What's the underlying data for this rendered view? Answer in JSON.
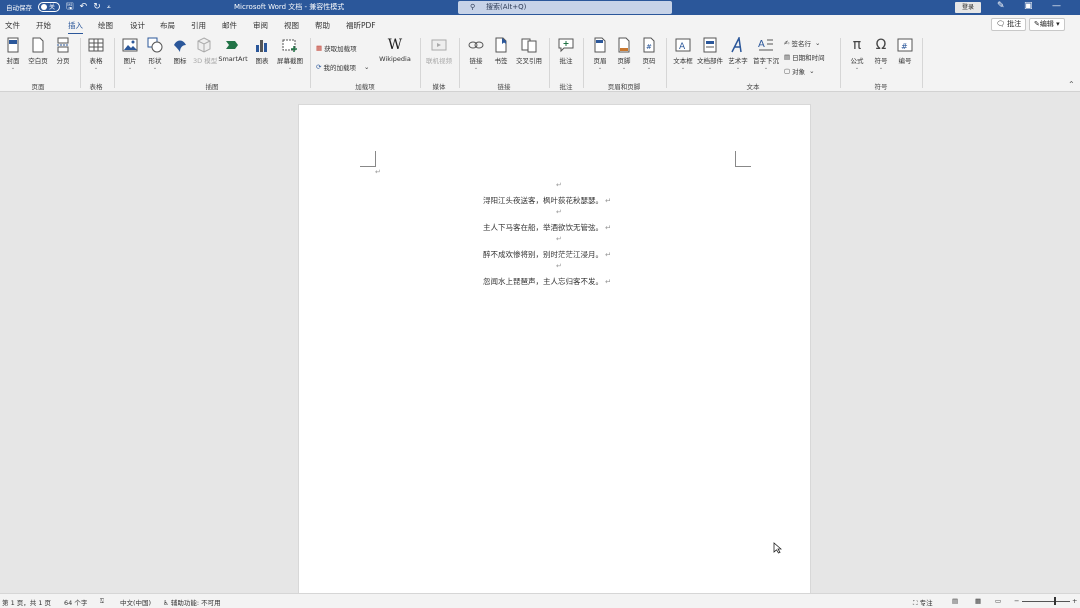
{
  "titlebar": {
    "autosave_label": "自动保存",
    "autosave_state": "关",
    "document_title": "Microsoft Word 文档  -  兼容性模式",
    "search_placeholder": "搜索(Alt+Q)",
    "login_label": "登录"
  },
  "menu": {
    "tabs": [
      "文件",
      "开始",
      "插入",
      "绘图",
      "设计",
      "布局",
      "引用",
      "邮件",
      "审阅",
      "视图",
      "帮助",
      "福昕PDF"
    ],
    "active_tab": "插入",
    "comments_label": "批注",
    "edit_label": "编辑"
  },
  "ribbon": {
    "groups": {
      "pages": "页面",
      "tables": "表格",
      "illustrations": "插图",
      "addins": "加载项",
      "media": "媒体",
      "links": "链接",
      "comments": "批注",
      "header_footer": "页眉和页脚",
      "text": "文本",
      "symbols": "符号"
    },
    "buttons": {
      "cover": "封面",
      "blank_page": "空白页",
      "page_break": "分页",
      "table": "表格",
      "picture": "图片",
      "shapes": "形状",
      "icons": "图标",
      "models_3d": "3D 模型",
      "smartart": "SmartArt",
      "chart": "图表",
      "screenshot": "屏幕截图",
      "get_addins": "获取加载项",
      "my_addins": "我的加载项",
      "wikipedia": "Wikipedia",
      "online_video": "联机视频",
      "link": "链接",
      "bookmark": "书签",
      "cross_ref": "交叉引用",
      "comment": "批注",
      "header": "页眉",
      "footer": "页脚",
      "page_number": "页码",
      "textbox": "文本框",
      "quick_parts": "文档部件",
      "wordart": "艺术字",
      "drop_cap": "首字下沉",
      "signature": "签名行",
      "datetime": "日期和时间",
      "object": "对象",
      "equation": "公式",
      "symbol": "符号",
      "number": "编号"
    }
  },
  "document": {
    "lines": [
      "浔阳江头夜送客，枫叶荻花秋瑟瑟。",
      "主人下马客在船，举酒欲饮无管弦。",
      "醉不成欢惨将别，别时茫茫江浸月。",
      "忽闻水上琵琶声，主人忘归客不发。"
    ],
    "paragraph_mark": "↵"
  },
  "statusbar": {
    "page_info": "第 1 页，共 1 页",
    "word_count": "64 个字",
    "language": "中文(中国)",
    "accessibility": "辅助功能: 不可用",
    "focus": "专注"
  },
  "colors": {
    "title_bar": "#2b579a",
    "ribbon_bg": "#f3f3f3",
    "canvas_bg": "#e6e6e6"
  }
}
